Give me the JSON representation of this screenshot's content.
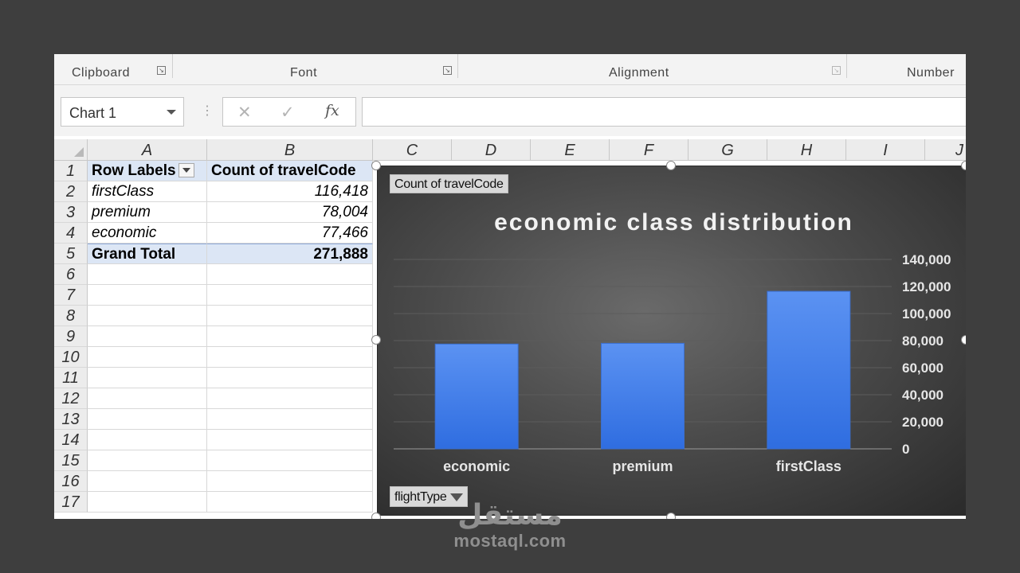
{
  "ribbon": {
    "groups": [
      "Clipboard",
      "Font",
      "Alignment",
      "Number"
    ]
  },
  "formula_bar": {
    "name_box": "Chart 1",
    "cancel": "✕",
    "enter": "✓",
    "fx": "fx",
    "formula": ""
  },
  "columns": [
    "A",
    "B",
    "C",
    "D",
    "E",
    "F",
    "G",
    "H",
    "I",
    "J"
  ],
  "rows": [
    "1",
    "2",
    "3",
    "4",
    "5",
    "6",
    "7",
    "8",
    "9",
    "10",
    "11",
    "12",
    "13",
    "14",
    "15",
    "16",
    "17"
  ],
  "pivot": {
    "header": {
      "row_labels": "Row Labels",
      "count": "Count of travelCode"
    },
    "rows": [
      {
        "label": "firstClass",
        "value": "116,418"
      },
      {
        "label": "premium",
        "value": "78,004"
      },
      {
        "label": "economic",
        "value": "77,466"
      }
    ],
    "total": {
      "label": "Grand Total",
      "value": "271,888"
    }
  },
  "chart": {
    "value_field_button": "Count of travelCode",
    "axis_field_button": "flightType",
    "title": "economic class distribution",
    "bar_color": "#4f87ee",
    "background": "#3f3f3f"
  },
  "chart_data": {
    "type": "bar",
    "title": "economic class distribution",
    "categories": [
      "economic",
      "premium",
      "firstClass"
    ],
    "values": [
      77466,
      78004,
      116418
    ],
    "xlabel": "",
    "ylabel": "",
    "ylim": [
      0,
      140000
    ],
    "yticks": [
      "0",
      "20,000",
      "40,000",
      "60,000",
      "80,000",
      "100,000",
      "120,000",
      "140,000"
    ],
    "y_axis_side": "right",
    "grid": true,
    "legend": "none"
  },
  "watermark": {
    "arabic": "مستقل",
    "latin": "mostaql.com"
  }
}
